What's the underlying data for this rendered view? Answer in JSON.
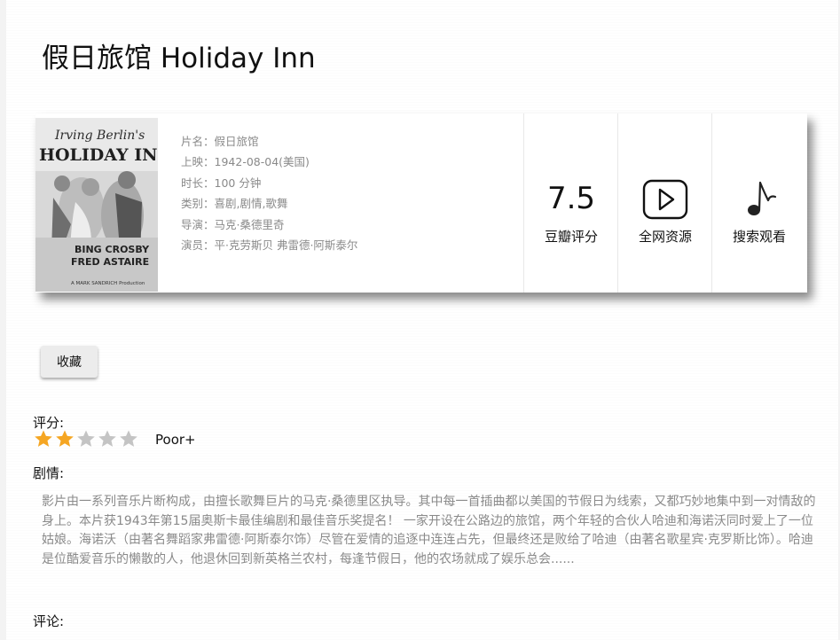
{
  "movie": {
    "title": "假日旅馆 Holiday Inn",
    "poster_texts": {
      "top": "Irving Berlin's",
      "main": "HOLIDAY INN",
      "cast1": "BING CROSBY",
      "cast2": "FRED ASTAIRE",
      "credit": "A MARK SANDRICH Production"
    },
    "info": [
      {
        "label": "片名：",
        "value": "假日旅馆"
      },
      {
        "label": "上映：",
        "value": "1942-08-04(美国)"
      },
      {
        "label": "时长：",
        "value": "100 分钟"
      },
      {
        "label": "类别：",
        "value": "喜剧,剧情,歌舞"
      },
      {
        "label": "导演：",
        "value": "马克·桑德里奇"
      },
      {
        "label": "演员：",
        "value": "平·克劳斯贝 弗雷德·阿斯泰尔"
      }
    ],
    "score": "7.5",
    "score_label": "豆瓣评分",
    "resources_label": "全网资源",
    "search_label": "搜索观看"
  },
  "actions": {
    "favorite_label": "收藏"
  },
  "rating": {
    "label": "评分:",
    "stars_filled": 2,
    "stars_total": 5,
    "text": "Poor+",
    "star_color_on": "#f5a623",
    "star_color_off": "#c4c4c4"
  },
  "plot": {
    "label": "剧情:",
    "text": "影片由一系列音乐片断构成，由擅长歌舞巨片的马克·桑德里区执导。其中每一首插曲都以美国的节假日为线索，又都巧妙地集中到一对情敌的身上。本片获1943年第15届奥斯卡最佳编剧和最佳音乐奖提名！ 一家开设在公路边的旅馆，两个年轻的合伙人哈迪和海诺沃同时爱上了一位姑娘。海诺沃（由著名舞蹈家弗雷德·阿斯泰尔饰）尽管在爱情的追逐中连连占先，但最终还是败给了哈迪（由著名歌星宾·克罗斯比饰）。哈迪是位酷爱音乐的懒散的人，他退休回到新英格兰农村，每逢节假日，他的农场就成了娱乐总会......"
  },
  "comments": {
    "label": "评论:"
  }
}
